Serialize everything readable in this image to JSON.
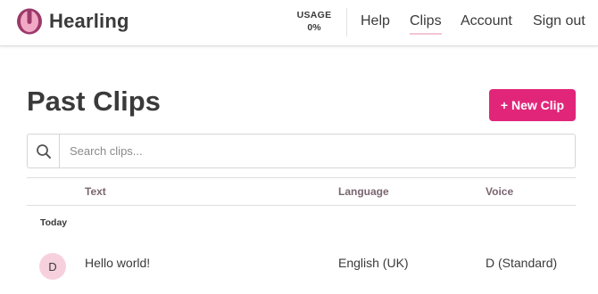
{
  "app": {
    "name": "Hearling"
  },
  "usage": {
    "label": "USAGE",
    "value": "0%"
  },
  "nav": {
    "help": "Help",
    "clips": "Clips",
    "account": "Account",
    "signout": "Sign out"
  },
  "page": {
    "title": "Past Clips",
    "new_clip_label": "+ New Clip"
  },
  "search": {
    "placeholder": "Search clips...",
    "value": ""
  },
  "table": {
    "columns": {
      "text": "Text",
      "language": "Language",
      "voice": "Voice"
    },
    "groups": [
      {
        "label": "Today",
        "rows": [
          {
            "avatar": "D",
            "text": "Hello world!",
            "language": "English (UK)",
            "voice": "D (Standard)"
          }
        ]
      }
    ]
  },
  "colors": {
    "accent": "#e1267a",
    "avatar_bg": "#f7d0de",
    "logo_outer": "#9b3a6b",
    "logo_inner": "#f2a9c6"
  }
}
